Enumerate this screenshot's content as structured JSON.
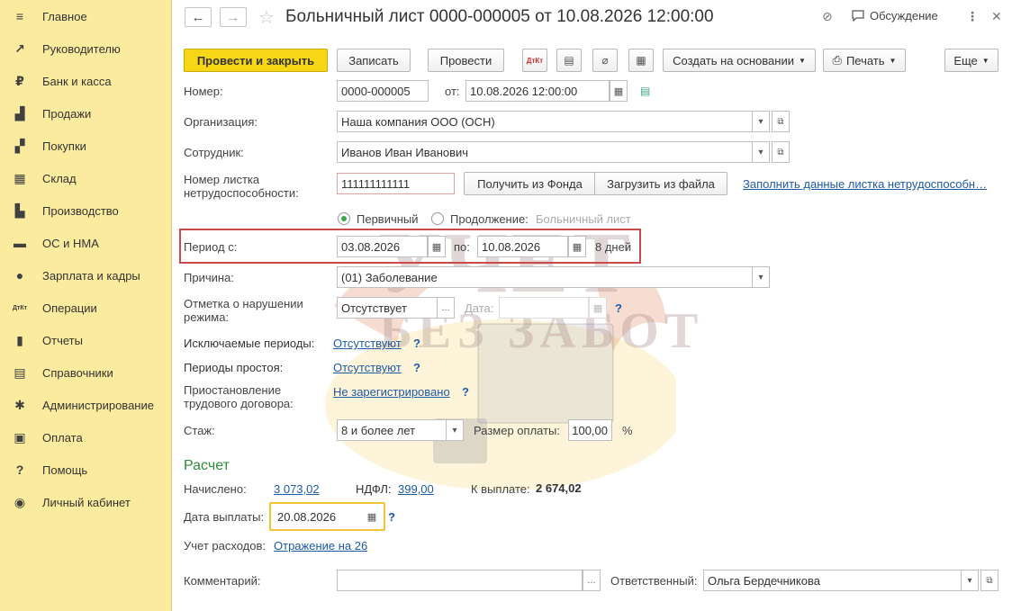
{
  "sidebar": {
    "items": [
      {
        "label": "Главное",
        "icon": "menu-icon",
        "glyph": "≡"
      },
      {
        "label": "Руководителю",
        "icon": "trend-icon",
        "glyph": "↗"
      },
      {
        "label": "Банк и касса",
        "icon": "ruble-coin-icon",
        "glyph": "₽"
      },
      {
        "label": "Продажи",
        "icon": "shopping-bag-icon",
        "glyph": "▟"
      },
      {
        "label": "Покупки",
        "icon": "shopping-cart-icon",
        "glyph": "▞"
      },
      {
        "label": "Склад",
        "icon": "warehouse-icon",
        "glyph": "▦"
      },
      {
        "label": "Производство",
        "icon": "factory-icon",
        "glyph": "▙"
      },
      {
        "label": "ОС и НМА",
        "icon": "truck-icon",
        "glyph": "▬"
      },
      {
        "label": "Зарплата и кадры",
        "icon": "person-icon",
        "glyph": "●"
      },
      {
        "label": "Операции",
        "icon": "dt-kt-icon",
        "glyph": "ДтКт"
      },
      {
        "label": "Отчеты",
        "icon": "bar-chart-icon",
        "glyph": "▮"
      },
      {
        "label": "Справочники",
        "icon": "books-icon",
        "glyph": "▤"
      },
      {
        "label": "Администрирование",
        "icon": "gear-icon",
        "glyph": "✱"
      },
      {
        "label": "Оплата",
        "icon": "wallet-icon",
        "glyph": "▣"
      },
      {
        "label": "Помощь",
        "icon": "question-icon",
        "glyph": "?"
      },
      {
        "label": "Личный кабинет",
        "icon": "user-circle-icon",
        "glyph": "◉"
      }
    ]
  },
  "header": {
    "back": "←",
    "forward": "→",
    "star": "☆",
    "title": "Больничный лист 0000-000005 от 10.08.2026 12:00:00",
    "link_icon": "⊘",
    "discussion_label": "Обсуждение",
    "more_icon": "⋮",
    "close_icon": "✕"
  },
  "toolbar": {
    "post_close": "Провести и закрыть",
    "save": "Записать",
    "post": "Провести",
    "dtkt": "ДтКт",
    "create_based": "Создать на основании",
    "print": "Печать",
    "more": "Еще"
  },
  "form": {
    "number_label": "Номер:",
    "number_value": "0000-000005",
    "from_label": "от:",
    "date_value": "10.08.2026 12:00:00",
    "org_label": "Организация:",
    "org_value": "Наша компания ООО (ОСН)",
    "employee_label": "Сотрудник:",
    "employee_value": "Иванов Иван Иванович",
    "sheet_label_1": "Номер листка",
    "sheet_label_2": "нетрудоспособности:",
    "sheet_value": "111111111111",
    "get_from_fund": "Получить из Фонда",
    "load_from_file": "Загрузить из файла",
    "fill_link": "Заполнить данные листка нетрудоспособн…",
    "primary_label": "Первичный",
    "continuation_label": "Продолжение:",
    "sick_list_placeholder": "Больничный лист",
    "period_label": "Период с:",
    "period_from": "03.08.2026",
    "to_label": "по:",
    "period_to": "10.08.2026",
    "days": "8 дней",
    "reason_label": "Причина:",
    "reason_value": "(01) Заболевание",
    "violation_label_1": "Отметка о нарушении",
    "violation_label_2": "режима:",
    "violation_value": "Отсутствует",
    "date_label": "Дата:",
    "excluded_label": "Исключаемые периоды:",
    "excluded_link": "Отсутствуют",
    "idle_label": "Периоды простоя:",
    "idle_link": "Отсутствуют",
    "suspension_label_1": "Приостановление",
    "suspension_label_2": "трудового договора:",
    "suspension_link": "Не зарегистрировано",
    "experience_label": "Стаж:",
    "experience_value": "8 и более лет",
    "payment_size_label": "Размер оплаты:",
    "payment_size_value": "100,00",
    "percent": "%",
    "help": "?"
  },
  "calc": {
    "section_title": "Расчет",
    "accrued_label": "Начислено:",
    "accrued_value": "3 073,02",
    "ndfl_label": "НДФЛ:",
    "ndfl_value": "399,00",
    "payout_label": "К выплате:",
    "payout_value": "2 674,02",
    "pay_date_label": "Дата выплаты:",
    "pay_date_value": "20.08.2026",
    "expense_label": "Учет расходов:",
    "expense_link": "Отражение на 26"
  },
  "footer": {
    "comment_label": "Комментарий:",
    "comment_value": "",
    "responsible_label": "Ответственный:",
    "responsible_value": "Ольга Бердечникова"
  },
  "watermark": {
    "line1": "УЧЕТ",
    "line2": "БЕЗ ЗАБОТ"
  },
  "colors": {
    "sidebar_bg": "#fbeb9e",
    "primary_button": "#f6d615",
    "link": "#1e5aa8",
    "section": "#2e8b3b",
    "highlight_frame": "#c94a4a"
  }
}
